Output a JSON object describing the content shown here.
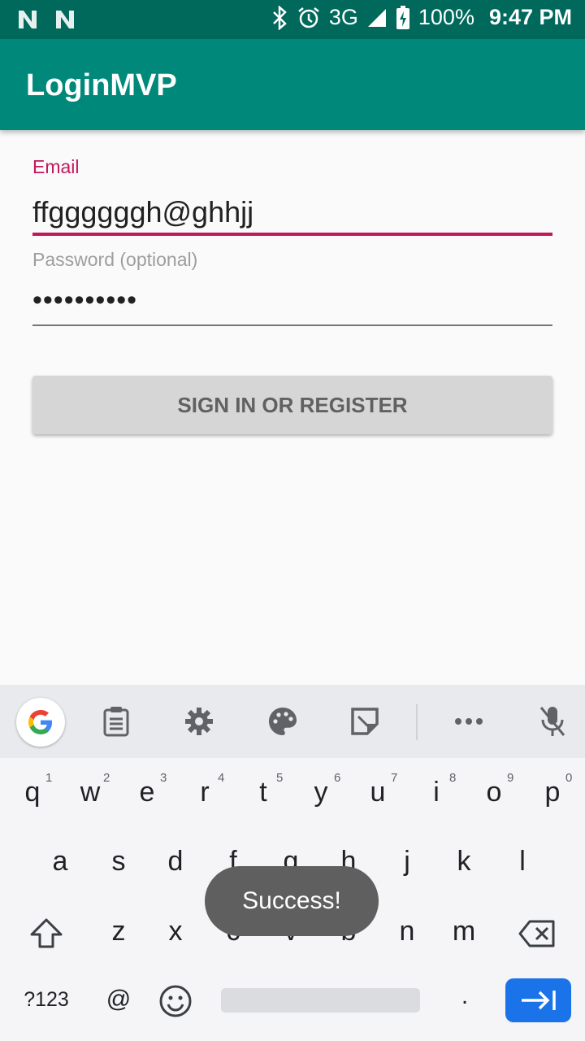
{
  "status_bar": {
    "left_icons": [
      "n-icon",
      "n-icon"
    ],
    "icons": [
      "bluetooth-icon",
      "alarm-icon"
    ],
    "network": "3G",
    "battery": "100%",
    "time": "9:47 PM"
  },
  "app_bar": {
    "title": "LoginMVP"
  },
  "form": {
    "email_label": "Email",
    "email_value": "ffggggggh@ghhjj",
    "password_label": "Password (optional)",
    "password_value": "••••••••••",
    "signin_label": "SIGN IN OR REGISTER"
  },
  "keyboard": {
    "toolbar": [
      "google-icon",
      "clipboard-icon",
      "settings-icon",
      "palette-icon",
      "sticker-icon",
      "more-icon",
      "mic-off-icon"
    ],
    "row1": [
      {
        "k": "q",
        "h": "1"
      },
      {
        "k": "w",
        "h": "2"
      },
      {
        "k": "e",
        "h": "3"
      },
      {
        "k": "r",
        "h": "4"
      },
      {
        "k": "t",
        "h": "5"
      },
      {
        "k": "y",
        "h": "6"
      },
      {
        "k": "u",
        "h": "7"
      },
      {
        "k": "i",
        "h": "8"
      },
      {
        "k": "o",
        "h": "9"
      },
      {
        "k": "p",
        "h": "0"
      }
    ],
    "row2": [
      "a",
      "s",
      "d",
      "f",
      "g",
      "h",
      "j",
      "k",
      "l"
    ],
    "row3": [
      "z",
      "x",
      "c",
      "v",
      "b",
      "n",
      "m"
    ],
    "bottom": {
      "symbols": "?123",
      "at": "@",
      "period": "."
    },
    "accent_color": "#1a73e8"
  },
  "toast": {
    "message": "Success!"
  }
}
